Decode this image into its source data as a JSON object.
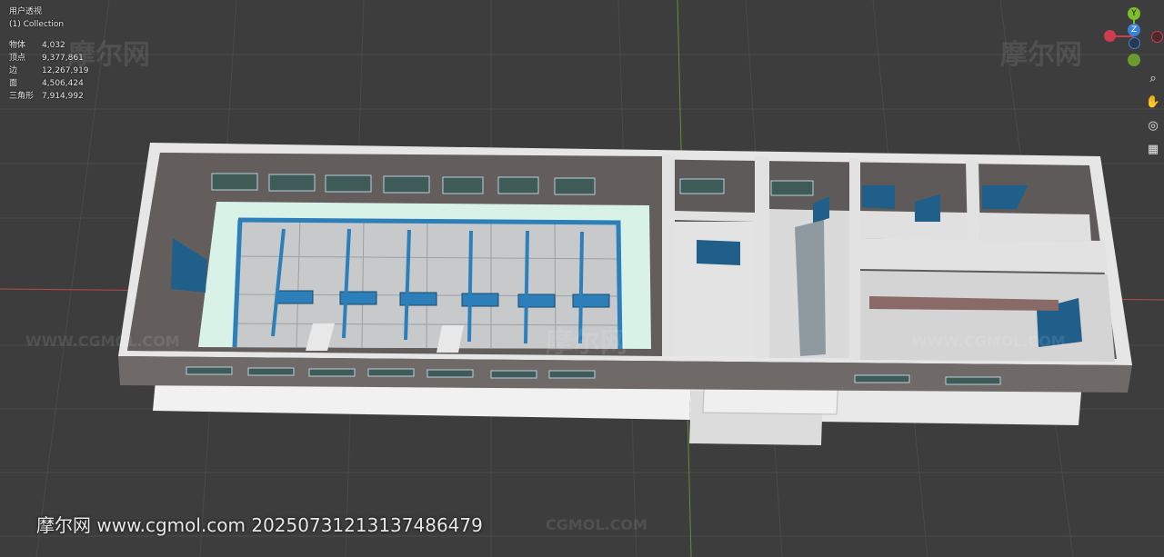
{
  "viewport": {
    "view_name": "用户透视",
    "collection": "(1) Collection",
    "stats": [
      {
        "label": "物体",
        "value": "4,032"
      },
      {
        "label": "顶点",
        "value": "9,377,861"
      },
      {
        "label": "边",
        "value": "12,267,919"
      },
      {
        "label": "面",
        "value": "4,506,424"
      },
      {
        "label": "三角形",
        "value": "7,914,992"
      }
    ]
  },
  "gizmo": {
    "axis_y": "Y",
    "axis_z": "Z"
  },
  "nav_tools": {
    "zoom_icon": "zoom-icon",
    "pan_icon": "hand-icon",
    "camera_icon": "camera-icon",
    "perspective_icon": "grid-icon"
  },
  "watermarks": {
    "brand_cn": "摩尔网",
    "brand_url": "WWW.CGMOL.COM",
    "brand_domain": "CGMOL.COM",
    "footer": "摩尔网 www.cgmol.com 20250731213137486479"
  },
  "colors": {
    "background": "#3d3d3d",
    "grid": "#4a4a4a",
    "axis_red": "#b84a4a",
    "axis_green": "#6b8a3a",
    "wall_light": "#e9e9e9",
    "wall_inner": "#6a6563",
    "floor": "#b9b9b9",
    "window_blue": "#1f5f8a",
    "pipe_blue": "#2c7fb8",
    "mint": "#d9f2e8",
    "gizmo_y": "#7dbd2e",
    "gizmo_z": "#3b82d9",
    "gizmo_x": "#cc3d4d"
  }
}
